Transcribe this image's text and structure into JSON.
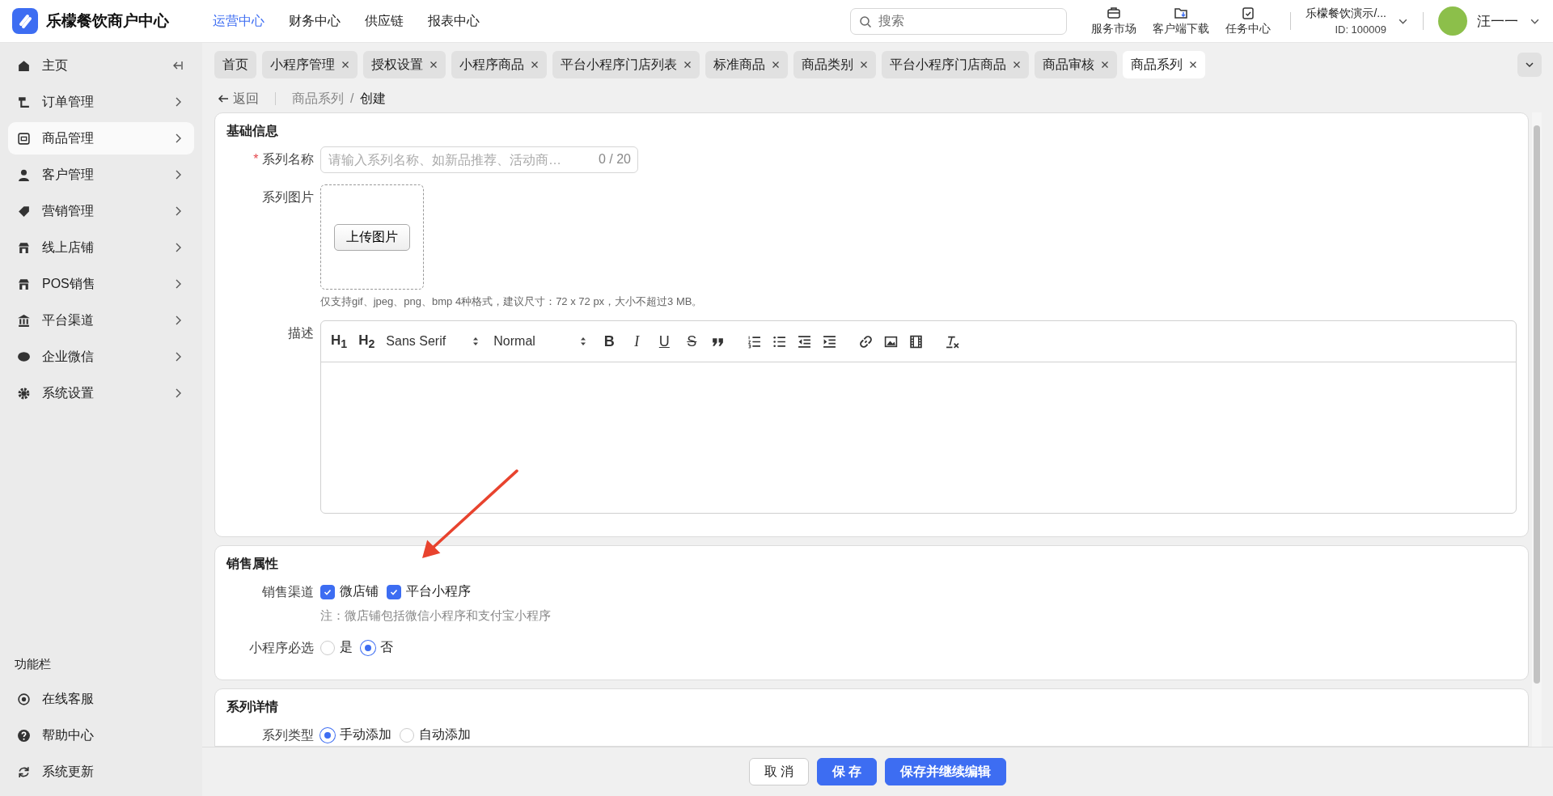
{
  "header": {
    "logo_text": "乐檬餐饮商户中心",
    "nav": [
      {
        "label": "运营中心",
        "selected": true
      },
      {
        "label": "财务中心",
        "selected": false
      },
      {
        "label": "供应链",
        "selected": false
      },
      {
        "label": "报表中心",
        "selected": false
      }
    ],
    "search": {
      "placeholder": "搜索"
    },
    "tools": [
      {
        "label": "服务市场",
        "kind": "market"
      },
      {
        "label": "客户端下载",
        "kind": "download"
      },
      {
        "label": "任务中心",
        "kind": "task"
      }
    ],
    "account": {
      "name": "乐檬餐饮演示/...",
      "id": "ID: 100009"
    },
    "user": {
      "name": "汪一一"
    }
  },
  "sidebar": {
    "items": [
      {
        "label": "主页",
        "kind": "home",
        "selected": false
      },
      {
        "label": "订单管理",
        "kind": "order",
        "selected": false
      },
      {
        "label": "商品管理",
        "kind": "goods",
        "selected": true
      },
      {
        "label": "客户管理",
        "kind": "person",
        "selected": false
      },
      {
        "label": "营销管理",
        "kind": "tag",
        "selected": false
      },
      {
        "label": "线上店铺",
        "kind": "store",
        "selected": false
      },
      {
        "label": "POS销售",
        "kind": "store",
        "selected": false
      },
      {
        "label": "平台渠道",
        "kind": "bank",
        "selected": false
      },
      {
        "label": "企业微信",
        "kind": "chat",
        "selected": false
      },
      {
        "label": "系统设置",
        "kind": "gear",
        "selected": false
      }
    ],
    "function_bar": {
      "title": "功能栏",
      "items": [
        {
          "label": "在线客服",
          "kind": "support"
        },
        {
          "label": "帮助中心",
          "kind": "help"
        },
        {
          "label": "系统更新",
          "kind": "refresh"
        }
      ]
    }
  },
  "tabs": [
    {
      "label": "首页",
      "closable": false,
      "selected": false
    },
    {
      "label": "小程序管理",
      "closable": true,
      "selected": false
    },
    {
      "label": "授权设置",
      "closable": true,
      "selected": false
    },
    {
      "label": "小程序商品",
      "closable": true,
      "selected": false
    },
    {
      "label": "平台小程序门店列表",
      "closable": true,
      "selected": false
    },
    {
      "label": "标准商品",
      "closable": true,
      "selected": false
    },
    {
      "label": "商品类别",
      "closable": true,
      "selected": false
    },
    {
      "label": "平台小程序门店商品",
      "closable": true,
      "selected": false
    },
    {
      "label": "商品审核",
      "closable": true,
      "selected": false
    },
    {
      "label": "商品系列",
      "closable": true,
      "selected": true
    }
  ],
  "breadcrumb": {
    "back": "返回",
    "separator": "/",
    "path": [
      {
        "label": "商品系列",
        "current": false
      },
      {
        "label": "创建",
        "current": true
      }
    ]
  },
  "sections": [
    {
      "title": "基础信息",
      "fields": [
        {
          "kind": "text-input",
          "label": "系列名称",
          "required_mark": "*",
          "placeholder": "请输入系列名称、如新品推荐、活动商…",
          "counter": "0 / 20"
        },
        {
          "kind": "upload",
          "label": "系列图片",
          "button": "上传图片",
          "hint": "仅支持gif、jpeg、png、bmp 4种格式，建议尺寸：72 x 72 px，大小不超过3 MB。"
        },
        {
          "kind": "editor",
          "label": "描述",
          "toolbar": [
            {
              "kind": "heading",
              "label": "H$_{1}$"
            },
            {
              "kind": "heading",
              "label": "H$_{2}$"
            },
            {
              "kind": "select",
              "label": "Sans Serif"
            },
            {
              "kind": "select",
              "label": "Normal"
            },
            {
              "kind": "bold",
              "label": "B"
            },
            {
              "kind": "italic",
              "label": "I"
            },
            {
              "kind": "underline",
              "label": "U"
            },
            {
              "kind": "strike",
              "label": "S"
            },
            {
              "kind": "quote"
            },
            {
              "kind": "ordered-list"
            },
            {
              "kind": "bullet-list"
            },
            {
              "kind": "outdent"
            },
            {
              "kind": "indent"
            },
            {
              "kind": "link"
            },
            {
              "kind": "image"
            },
            {
              "kind": "video"
            },
            {
              "kind": "clear-format"
            }
          ]
        }
      ]
    },
    {
      "title": "销售属性",
      "fields": [
        {
          "kind": "checkboxes",
          "label": "销售渠道",
          "options": [
            {
              "label": "微店铺",
              "checked": true
            },
            {
              "label": "平台小程序",
              "checked": true
            }
          ],
          "note": "注：微店铺包括微信小程序和支付宝小程序"
        },
        {
          "kind": "radios",
          "label": "小程序必选",
          "options": [
            {
              "label": "是",
              "selected": false
            },
            {
              "label": "否",
              "selected": true
            }
          ]
        }
      ]
    },
    {
      "title": "系列详情",
      "fields": [
        {
          "kind": "radios",
          "label": "系列类型",
          "options": [
            {
              "label": "手动添加",
              "selected": true
            },
            {
              "label": "自动添加",
              "selected": false
            }
          ]
        }
      ]
    }
  ],
  "footer": {
    "buttons": [
      {
        "label": "取 消",
        "kind": "default"
      },
      {
        "label": "保 存",
        "kind": "primary"
      },
      {
        "label": "保存并继续编辑",
        "kind": "primary"
      }
    ]
  },
  "annotations": [
    {
      "kind": "arrow"
    }
  ]
}
